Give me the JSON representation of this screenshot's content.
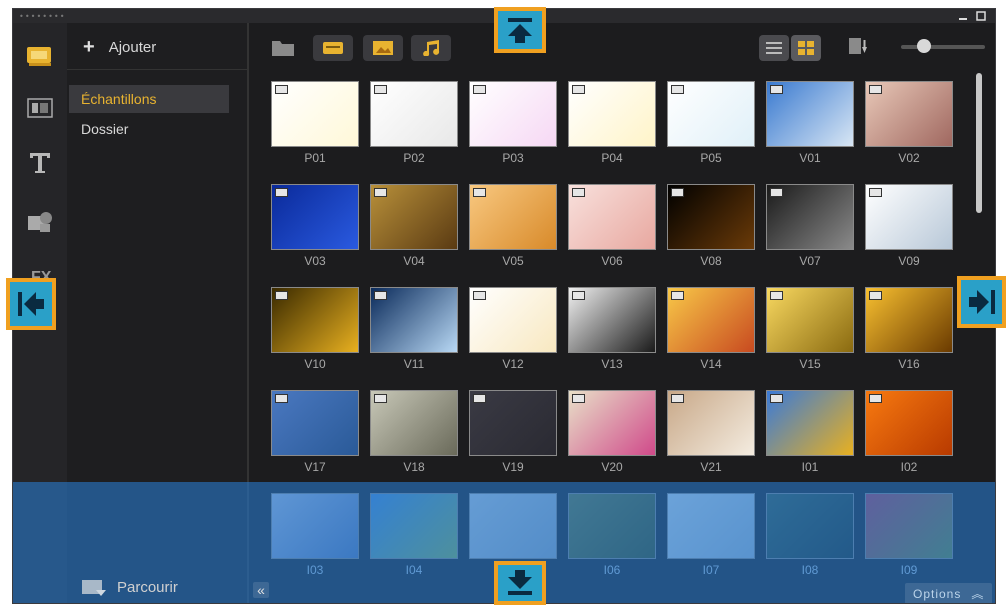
{
  "toolbar_add": "Ajouter",
  "folders": [
    "Échantillons",
    "Dossier"
  ],
  "browse_label": "Parcourir",
  "options_label": "Options",
  "thumbnails": [
    {
      "label": "P01",
      "c1": "#ffffff",
      "c2": "#fff8d8"
    },
    {
      "label": "P02",
      "c1": "#ffffff",
      "c2": "#e8e8e8"
    },
    {
      "label": "P03",
      "c1": "#ffffff",
      "c2": "#f6d8f4"
    },
    {
      "label": "P04",
      "c1": "#ffffff",
      "c2": "#fff4c8"
    },
    {
      "label": "P05",
      "c1": "#ffffff",
      "c2": "#e0f0f8"
    },
    {
      "label": "V01",
      "c1": "#3a7ad0",
      "c2": "#d8e6f4"
    },
    {
      "label": "V02",
      "c1": "#e8c8b8",
      "c2": "#a06860"
    },
    {
      "label": "V03",
      "c1": "#0a2a9a",
      "c2": "#2a5ae0"
    },
    {
      "label": "V04",
      "c1": "#b8903a",
      "c2": "#5a3a12"
    },
    {
      "label": "V05",
      "c1": "#f8c880",
      "c2": "#d88a2a"
    },
    {
      "label": "V06",
      "c1": "#f8e0dc",
      "c2": "#e8a8a0"
    },
    {
      "label": "V08",
      "c1": "#000000",
      "c2": "#6a3a08"
    },
    {
      "label": "V07",
      "c1": "#1a1a1a",
      "c2": "#8a8a8a"
    },
    {
      "label": "V09",
      "c1": "#ffffff",
      "c2": "#b8c8d8"
    },
    {
      "label": "V10",
      "c1": "#3a2a00",
      "c2": "#e8b020"
    },
    {
      "label": "V11",
      "c1": "#0a2a5a",
      "c2": "#b8d8f4"
    },
    {
      "label": "V12",
      "c1": "#ffffff",
      "c2": "#f8e8c0"
    },
    {
      "label": "V13",
      "c1": "#f0f0f0",
      "c2": "#1a1a1a"
    },
    {
      "label": "V14",
      "c1": "#f8c848",
      "c2": "#c84a20"
    },
    {
      "label": "V15",
      "c1": "#f8d860",
      "c2": "#8a6a10"
    },
    {
      "label": "V16",
      "c1": "#f8c030",
      "c2": "#6a3a00"
    },
    {
      "label": "V17",
      "c1": "#4a78c0",
      "c2": "#2a5a98"
    },
    {
      "label": "V18",
      "c1": "#c8c8b8",
      "c2": "#6a6a5a"
    },
    {
      "label": "V19",
      "c1": "#3a3a44",
      "c2": "#2a2a32"
    },
    {
      "label": "V20",
      "c1": "#e8e0c8",
      "c2": "#d04a8a"
    },
    {
      "label": "V21",
      "c1": "#c8a888",
      "c2": "#f4ece0"
    },
    {
      "label": "I01",
      "c1": "#3a7ad8",
      "c2": "#e8b020"
    },
    {
      "label": "I02",
      "c1": "#f87a10",
      "c2": "#b83a00"
    },
    {
      "label": "I03",
      "c1": "#b8c8e8",
      "c2": "#5a7ab8"
    },
    {
      "label": "I04",
      "c1": "#4a90e0",
      "c2": "#8ab858"
    },
    {
      "label": "",
      "c1": "#c8d8e8",
      "c2": "#9ab0c8"
    },
    {
      "label": "I06",
      "c1": "#6a7a40",
      "c2": "#3a4a1a"
    },
    {
      "label": "I07",
      "c1": "#d8e8f4",
      "c2": "#a8c0d8"
    },
    {
      "label": "I08",
      "c1": "#3a5a4a",
      "c2": "#1a2a24"
    },
    {
      "label": "I09",
      "c1": "#b83a5a",
      "c2": "#6a8a3a"
    }
  ],
  "colors": {
    "accent": "#e8b330",
    "highlight": "#f0a020",
    "arrow": "#2aa0c8"
  }
}
